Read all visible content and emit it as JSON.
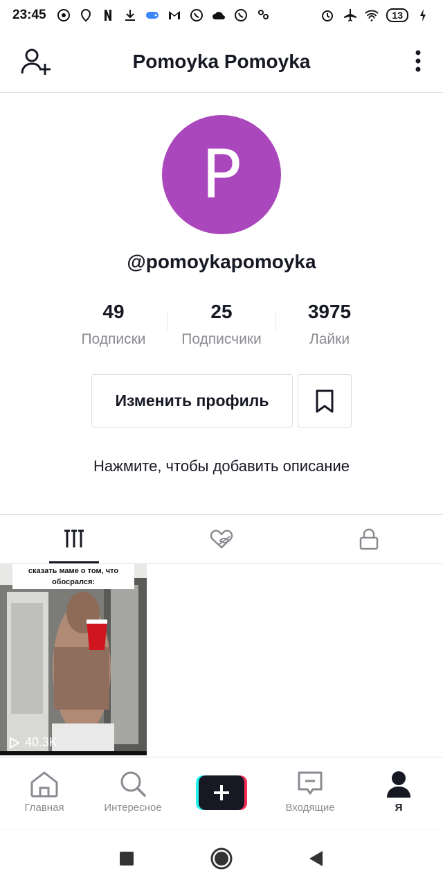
{
  "status_bar": {
    "time": "23:45",
    "battery": "13"
  },
  "header": {
    "title": "Pomoyka Pomoyka"
  },
  "profile": {
    "avatar_letter": "P",
    "avatar_color": "#ab47bc",
    "username": "@pomoykapomoyka",
    "stats": [
      {
        "value": "49",
        "label": "Подписки"
      },
      {
        "value": "25",
        "label": "Подписчики"
      },
      {
        "value": "3975",
        "label": "Лайки"
      }
    ],
    "edit_button": "Изменить профиль",
    "bio_placeholder": "Нажмите, чтобы добавить описание"
  },
  "tabs": [
    {
      "icon": "grid-icon",
      "active": true
    },
    {
      "icon": "liked-hidden-icon",
      "active": false
    },
    {
      "icon": "lock-icon",
      "active": false
    }
  ],
  "videos": [
    {
      "caption": "сказать маме о том, что обосрался:",
      "views": "40.3K"
    }
  ],
  "bottom_nav": {
    "home": "Главная",
    "discover": "Интересное",
    "inbox": "Входящие",
    "me": "Я"
  },
  "colors": {
    "text": "#161823",
    "muted": "#8a8b91",
    "accent_cyan": "#25f4ee",
    "accent_red": "#fe2c55"
  }
}
